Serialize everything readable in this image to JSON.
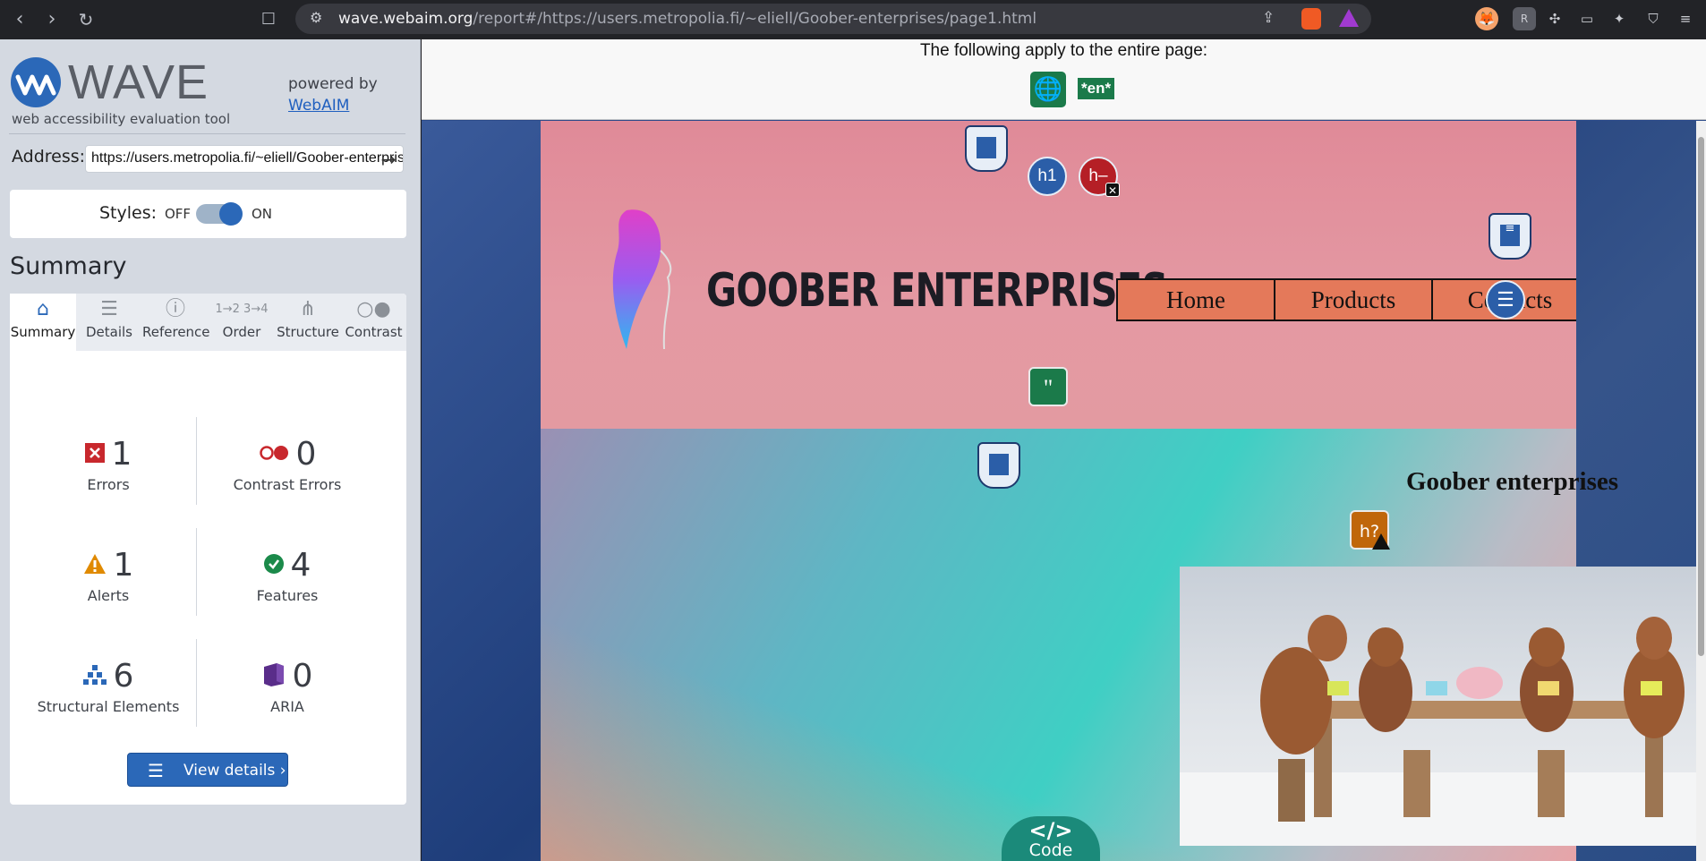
{
  "browser": {
    "url_host": "wave.webaim.org",
    "url_rest": "/report#/https://users.metropolia.fi/~eliell/Goober-enterprises/page1.html"
  },
  "wave": {
    "logo_text": "WAVE",
    "logo_subtitle": "web accessibility evaluation tool",
    "powered_by": "powered by",
    "webaim_link": "WebAIM",
    "address_label": "Address:",
    "address_value": "https://users.metropolia.fi/~eliell/Goober-enterprises/page1.html",
    "styles_label": "Styles:",
    "styles_off": "OFF",
    "styles_on": "ON",
    "styles_state": "on",
    "summary_title": "Summary",
    "tabs": [
      {
        "label": "Summary",
        "icon": "home-icon",
        "active": true
      },
      {
        "label": "Details",
        "icon": "list-icon",
        "active": false
      },
      {
        "label": "Reference",
        "icon": "info-icon",
        "active": false
      },
      {
        "label": "Order",
        "icon": "order-icon",
        "active": false
      },
      {
        "label": "Structure",
        "icon": "structure-icon",
        "active": false
      },
      {
        "label": "Contrast",
        "icon": "contrast-icon",
        "active": false
      }
    ],
    "stats": [
      {
        "label": "Errors",
        "count": "1",
        "icon": "error-icon",
        "color": "#c8282d"
      },
      {
        "label": "Contrast Errors",
        "count": "0",
        "icon": "contrast-error-icon",
        "color": "#c8282d"
      },
      {
        "label": "Alerts",
        "count": "1",
        "icon": "alert-icon",
        "color": "#e08a00"
      },
      {
        "label": "Features",
        "count": "4",
        "icon": "feature-icon",
        "color": "#1b8a4a"
      },
      {
        "label": "Structural Elements",
        "count": "6",
        "icon": "structure-icon",
        "color": "#2b68b8"
      },
      {
        "label": "ARIA",
        "count": "0",
        "icon": "aria-icon",
        "color": "#5a2d8a"
      }
    ],
    "view_details": "View details ›"
  },
  "report": {
    "page_notice": "The following apply to the entire page:",
    "language_code": "*en*",
    "site_title": "GOOBER ENTERPRISES",
    "nav": [
      "Home",
      "Products",
      "Contacts"
    ],
    "heading": "Goober enterprises",
    "code_button": "Code",
    "code_glyph": "</>",
    "icon_labels": {
      "h1": "h1",
      "h_empty": "h–",
      "h_question": "h?"
    }
  }
}
